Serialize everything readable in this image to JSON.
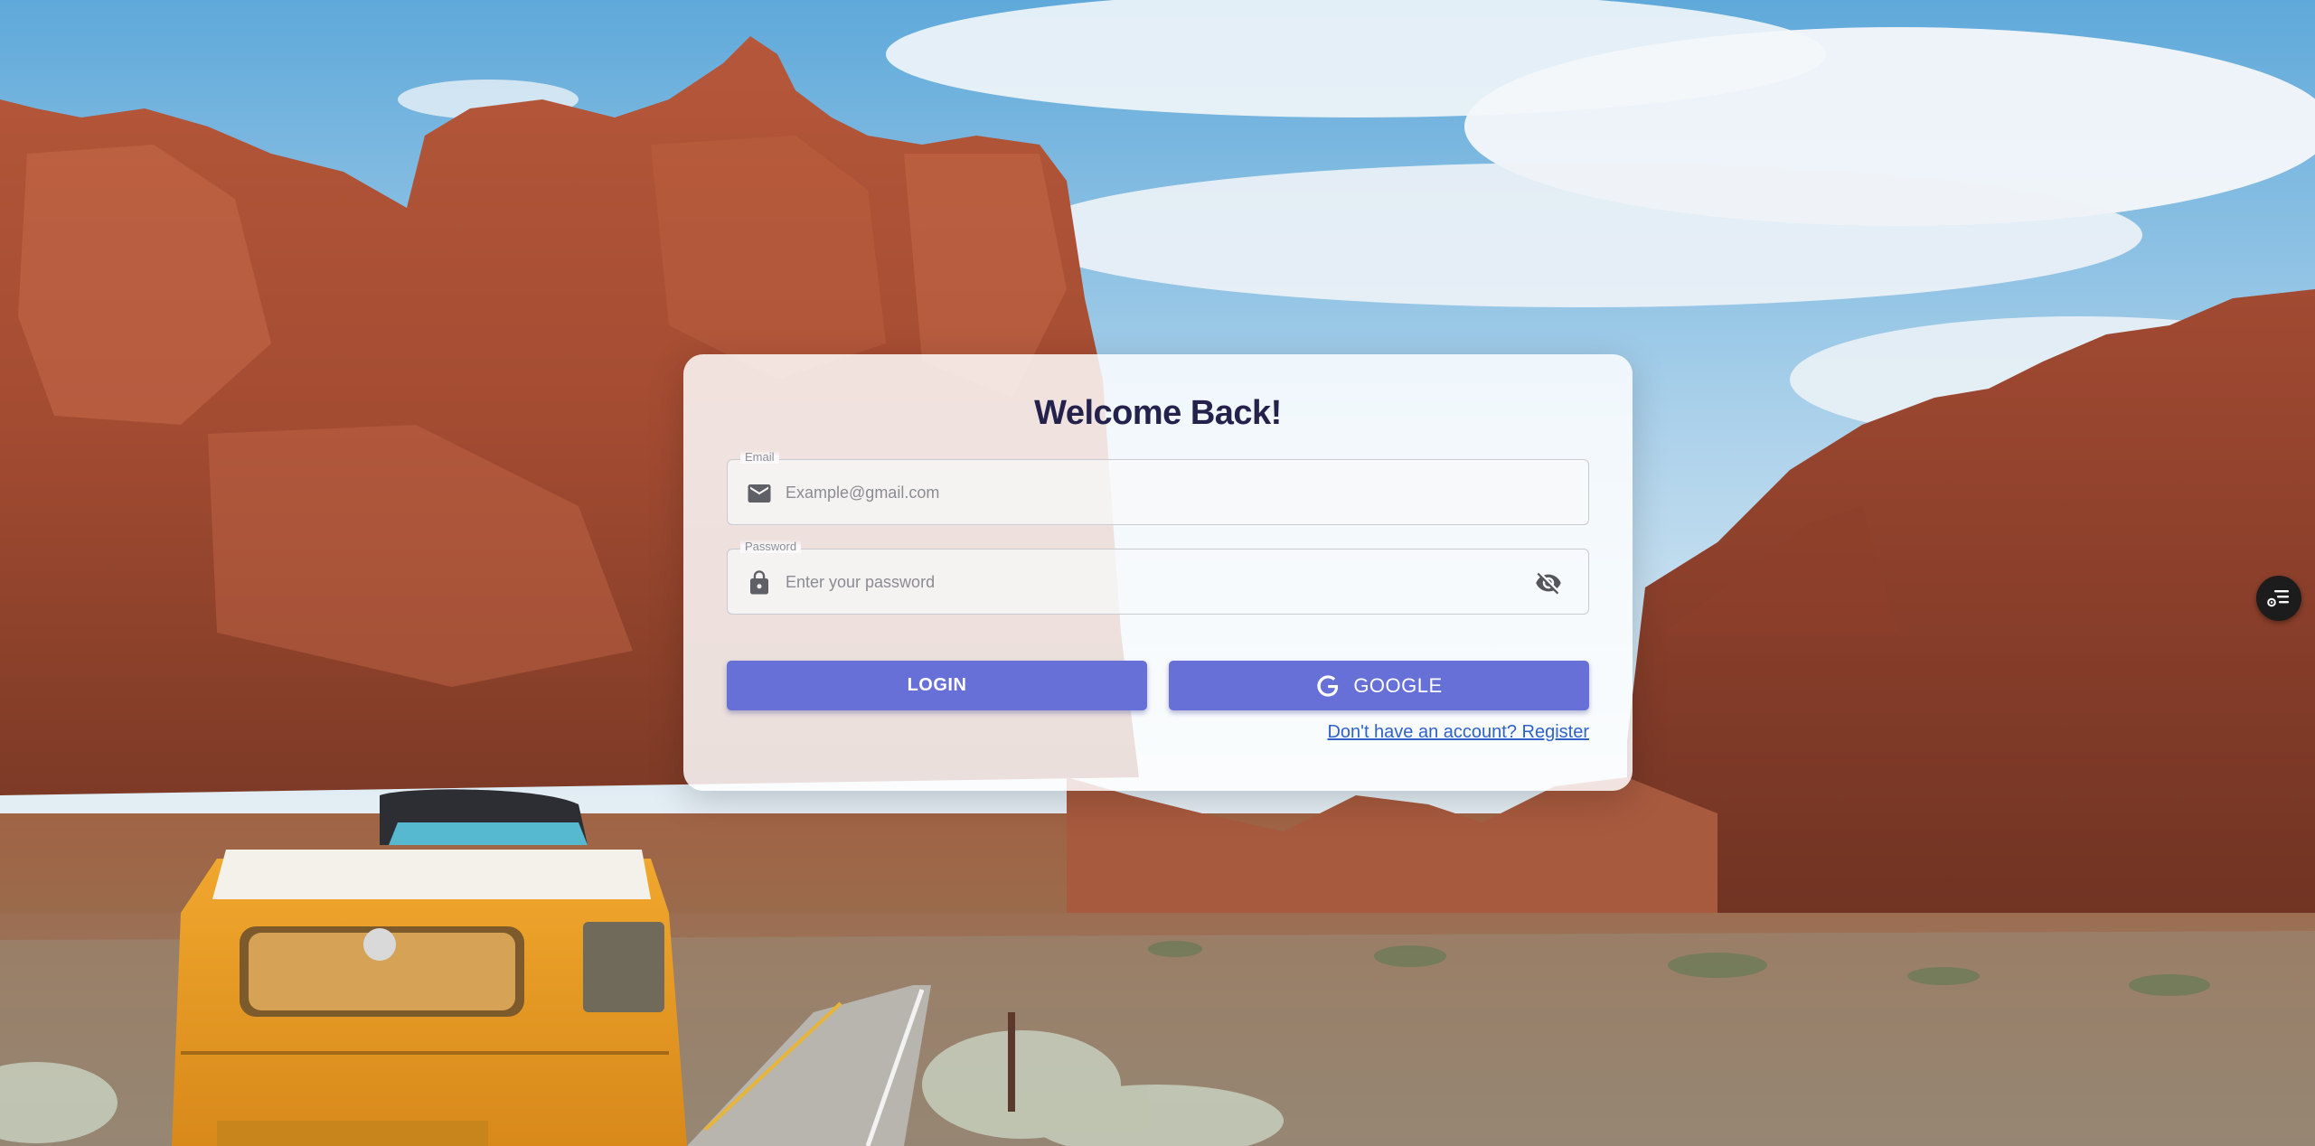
{
  "login": {
    "title": "Welcome Back!",
    "email": {
      "label": "Email",
      "placeholder": "Example@gmail.com",
      "value": "",
      "icon": "mail-icon"
    },
    "password": {
      "label": "Password",
      "placeholder": "Enter your password",
      "value": "",
      "icon": "lock-icon",
      "toggle_icon": "eye-off-icon"
    },
    "login_button_label": "LOGIN",
    "google_button_label": "GOOGLE",
    "google_icon": "google-g-icon",
    "register_link": "Don't have an account? Register"
  },
  "floating_button": {
    "icon": "settings-list-icon"
  },
  "colors": {
    "primary": "#6670d7",
    "title": "#25214d",
    "link": "#2f62c8"
  }
}
